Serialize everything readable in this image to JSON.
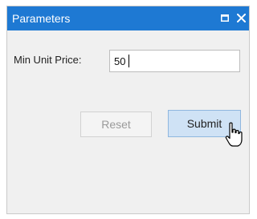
{
  "window": {
    "title": "Parameters",
    "maximize_icon": "maximize-icon",
    "close_icon": "close-icon",
    "title_bar_color": "#1e79d3"
  },
  "form": {
    "min_unit_price_label": "Min Unit Price:",
    "min_unit_price_value": "50"
  },
  "actions": {
    "reset_label": "Reset",
    "submit_label": "Submit"
  },
  "pointer": {
    "icon": "hand-pointer-cursor"
  }
}
